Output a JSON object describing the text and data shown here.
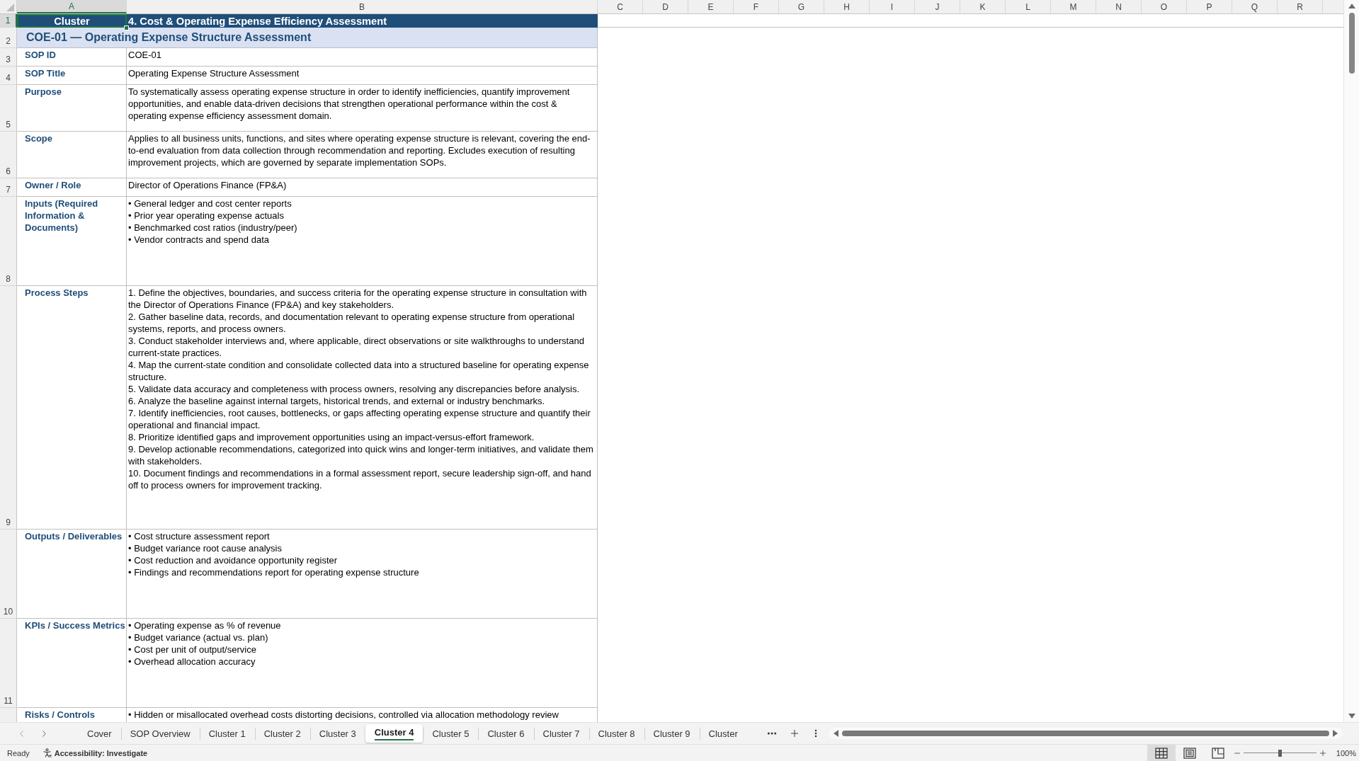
{
  "column_headers": [
    {
      "label": "A",
      "selected": true
    },
    {
      "label": "B",
      "selected": false
    },
    {
      "label": "C",
      "selected": false
    },
    {
      "label": "D",
      "selected": false
    },
    {
      "label": "E",
      "selected": false
    },
    {
      "label": "F",
      "selected": false
    },
    {
      "label": "G",
      "selected": false
    },
    {
      "label": "H",
      "selected": false
    },
    {
      "label": "I",
      "selected": false
    },
    {
      "label": "J",
      "selected": false
    },
    {
      "label": "K",
      "selected": false
    },
    {
      "label": "L",
      "selected": false
    },
    {
      "label": "M",
      "selected": false
    },
    {
      "label": "N",
      "selected": false
    },
    {
      "label": "O",
      "selected": false
    },
    {
      "label": "P",
      "selected": false
    },
    {
      "label": "Q",
      "selected": false
    },
    {
      "label": "R",
      "selected": false
    }
  ],
  "rows": [
    {
      "kind": "banner",
      "number": "1",
      "selected": true,
      "label": "Cluster",
      "value": "4. Cost & Operating Expense Efficiency Assessment"
    },
    {
      "kind": "section",
      "number": "2",
      "selected": false,
      "value": "COE-01 — Operating Expense Structure Assessment"
    },
    {
      "kind": "field",
      "number": "3",
      "selected": false,
      "label": "SOP ID",
      "value": "COE-01"
    },
    {
      "kind": "field",
      "number": "4",
      "selected": false,
      "label": "SOP Title",
      "value": "Operating Expense Structure Assessment"
    },
    {
      "kind": "field",
      "number": "5",
      "selected": false,
      "label": "Purpose",
      "value": "To systematically assess operating expense structure in order to identify inefficiencies, quantify improvement opportunities, and enable data-driven decisions that strengthen operational performance within the cost & operating expense efficiency assessment domain."
    },
    {
      "kind": "field",
      "number": "6",
      "selected": false,
      "label": "Scope",
      "value": "Applies to all business units, functions, and sites where operating expense structure is relevant, covering the end-to-end evaluation from data collection through recommendation and reporting. Excludes execution of resulting improvement projects, which are governed by separate implementation SOPs."
    },
    {
      "kind": "field",
      "number": "7",
      "selected": false,
      "label": "Owner / Role",
      "value": "Director of Operations Finance (FP&A)"
    },
    {
      "kind": "list",
      "number": "8",
      "selected": false,
      "label": "Inputs (Required Information & Documents)",
      "lines": [
        "• General ledger and cost center reports",
        "• Prior year operating expense actuals",
        "• Benchmarked cost ratios (industry/peer)",
        "• Vendor contracts and spend data"
      ]
    },
    {
      "kind": "list",
      "number": "9",
      "selected": false,
      "label": "Process Steps",
      "lines": [
        "1. Define the objectives, boundaries, and success criteria for the operating expense structure in consultation with the Director of Operations Finance (FP&A) and key stakeholders.",
        "2. Gather baseline data, records, and documentation relevant to operating expense structure from operational systems, reports, and process owners.",
        "3. Conduct stakeholder interviews and, where applicable, direct observations or site walkthroughs to understand current-state practices.",
        "4. Map the current-state condition and consolidate collected data into a structured baseline for operating expense structure.",
        "5. Validate data accuracy and completeness with process owners, resolving any discrepancies before analysis.",
        "6. Analyze the baseline against internal targets, historical trends, and external or industry benchmarks.",
        "7. Identify inefficiencies, root causes, bottlenecks, or gaps affecting operating expense structure and quantify their operational and financial impact.",
        "8. Prioritize identified gaps and improvement opportunities using an impact-versus-effort framework.",
        "9. Develop actionable recommendations, categorized into quick wins and longer-term initiatives, and validate them with stakeholders.",
        "10. Document findings and recommendations in a formal assessment report, secure leadership sign-off, and hand off to process owners for improvement tracking."
      ]
    },
    {
      "kind": "list",
      "number": "10",
      "selected": false,
      "label": "Outputs / Deliverables",
      "lines": [
        "• Cost structure assessment report",
        "• Budget variance root cause analysis",
        "• Cost reduction and avoidance opportunity register",
        "• Findings and recommendations report for operating expense structure"
      ]
    },
    {
      "kind": "list",
      "number": "11",
      "selected": false,
      "label": "KPIs / Success Metrics",
      "lines": [
        "• Operating expense as % of revenue",
        "• Budget variance (actual vs. plan)",
        "• Cost per unit of output/service",
        "• Overhead allocation accuracy"
      ]
    },
    {
      "kind": "list",
      "selected": false,
      "label": "Risks / Controls",
      "lines": [
        "• Hidden or misallocated overhead costs distorting decisions, controlled via allocation methodology review"
      ]
    }
  ],
  "sheet_tabs": [
    {
      "label": "Cover",
      "selected": false
    },
    {
      "label": "SOP Overview",
      "selected": false
    },
    {
      "label": "Cluster 1",
      "selected": false
    },
    {
      "label": "Cluster 2",
      "selected": false
    },
    {
      "label": "Cluster 3",
      "selected": false
    },
    {
      "label": "Cluster 4",
      "selected": true
    },
    {
      "label": "Cluster 5",
      "selected": false
    },
    {
      "label": "Cluster 6",
      "selected": false
    },
    {
      "label": "Cluster 7",
      "selected": false
    },
    {
      "label": "Cluster 8",
      "selected": false
    },
    {
      "label": "Cluster 9",
      "selected": false
    },
    {
      "label": "Cluster",
      "selected": false
    }
  ],
  "status_bar": {
    "mode": "Ready",
    "accessibility": "Accessibility: Investigate",
    "views": [
      {
        "kind": "normal",
        "selected": true
      },
      {
        "kind": "page_layout",
        "selected": false
      },
      {
        "kind": "page_break",
        "selected": false
      }
    ],
    "zoom": {
      "level": 0.5,
      "reading": "100%"
    }
  }
}
